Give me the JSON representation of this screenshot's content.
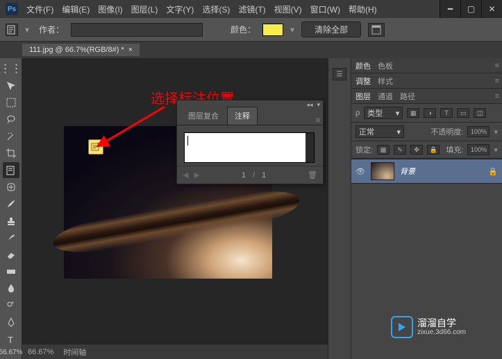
{
  "app": {
    "logo": "Ps"
  },
  "menus": [
    "文件(F)",
    "编辑(E)",
    "图像(I)",
    "图层(L)",
    "文字(Y)",
    "选择(S)",
    "滤镜(T)",
    "视图(V)",
    "窗口(W)",
    "帮助(H)"
  ],
  "optionsBar": {
    "authorLabel": "作者：",
    "authorValue": "",
    "colorLabel": "颜色：",
    "clearAll": "清除全部"
  },
  "docTab": {
    "label": "111.jpg @ 66.7%(RGB/8#) *"
  },
  "annotation": {
    "redText": "选择标注位置"
  },
  "notesPanel": {
    "tabs": [
      "图层复合",
      "注释"
    ],
    "activeTab": 1,
    "textValue": "",
    "current": "1",
    "total": "1"
  },
  "rightTabs1": [
    "颜色",
    "色板"
  ],
  "rightTabs2": [
    "调整",
    "样式"
  ],
  "layersPanel": {
    "tabs": [
      "图层",
      "通道",
      "路径"
    ],
    "typeDrop": "类型",
    "blendMode": "正常",
    "opacityLabel": "不透明度:",
    "opacityValue": "100%",
    "lockLabel": "锁定:",
    "fillLabel": "填充:",
    "fillValue": "100%",
    "layerName": "背景"
  },
  "zoomToolbox": "66.67%",
  "status": {
    "zoom": "66.67%",
    "timeline": "时间轴"
  },
  "watermark": {
    "title": "溜溜自学",
    "sub": "zixue.3d66.com"
  }
}
